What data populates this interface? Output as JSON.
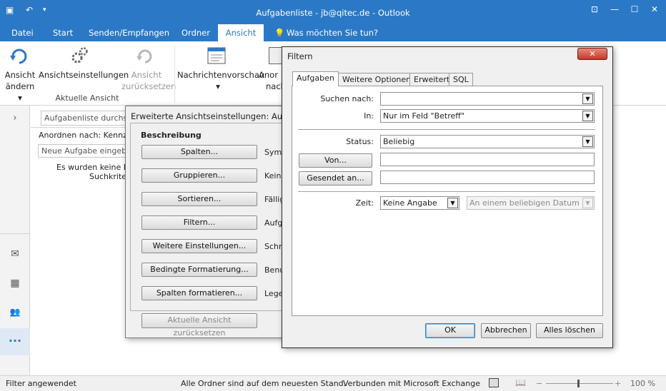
{
  "window": {
    "title": "Aufgabenliste - jb@qitec.de - Outlook"
  },
  "ribbon_tabs": [
    "Datei",
    "Start",
    "Senden/Empfangen",
    "Ordner",
    "Ansicht"
  ],
  "tell_me": "Was möchten Sie tun?",
  "ribbon": {
    "change_view_l1": "Ansicht",
    "change_view_l2": "ändern",
    "view_settings": "Ansichtseinstellungen",
    "reset_view_l1": "Ansicht",
    "reset_view_l2": "zurücksetzen",
    "group_label": "Aktuelle Ansicht",
    "message_preview": "Nachrichtenvorschau",
    "arrange_cut_l1": "Anor",
    "arrange_cut_l2": "nach"
  },
  "taskpane": {
    "search_placeholder": "Aufgabenliste durchsu",
    "arrange_by": "Anordnen nach: Kennze",
    "new_task_placeholder": "Neue Aufgabe eingebe",
    "empty_l1": "Es wurden keine El",
    "empty_l2": "Suchkriter"
  },
  "advanced_view_dialog": {
    "title": "Erweiterte Ansichtseinstellungen: Aufgab",
    "description_header": "Beschreibung",
    "buttons": [
      "Spalten...",
      "Gruppieren...",
      "Sortieren...",
      "Filtern...",
      "Weitere Einstellungen...",
      "Bedingte Formatierung...",
      "Spalten formatieren..."
    ],
    "descriptions": [
      "Symb",
      "Keine",
      "Fällig",
      "Aufg",
      "Schri",
      "Benu",
      "Lege"
    ],
    "reset_button": "Aktuelle Ansicht zurücksetzen"
  },
  "filter_dialog": {
    "title": "Filtern",
    "tabs": [
      "Aufgaben",
      "Weitere Optionen",
      "Erweitert",
      "SQL"
    ],
    "search_for_label": "Suchen nach:",
    "search_for_value": "",
    "in_label": "In:",
    "in_value": "Nur im Feld \"Betreff\"",
    "status_label": "Status:",
    "status_value": "Beliebig",
    "from_button": "Von...",
    "from_value": "",
    "sent_to_button": "Gesendet an...",
    "sent_to_value": "",
    "time_label": "Zeit:",
    "time_value": "Keine Angabe",
    "date_value": "An einem beliebigen Datum",
    "ok": "OK",
    "cancel": "Abbrechen",
    "clear_all": "Alles löschen"
  },
  "statusbar": {
    "filter": "Filter angewendet",
    "folders": "Alle Ordner sind auf dem neuesten Stand.",
    "connection": "Verbunden mit Microsoft Exchange",
    "zoom": "100 %"
  }
}
